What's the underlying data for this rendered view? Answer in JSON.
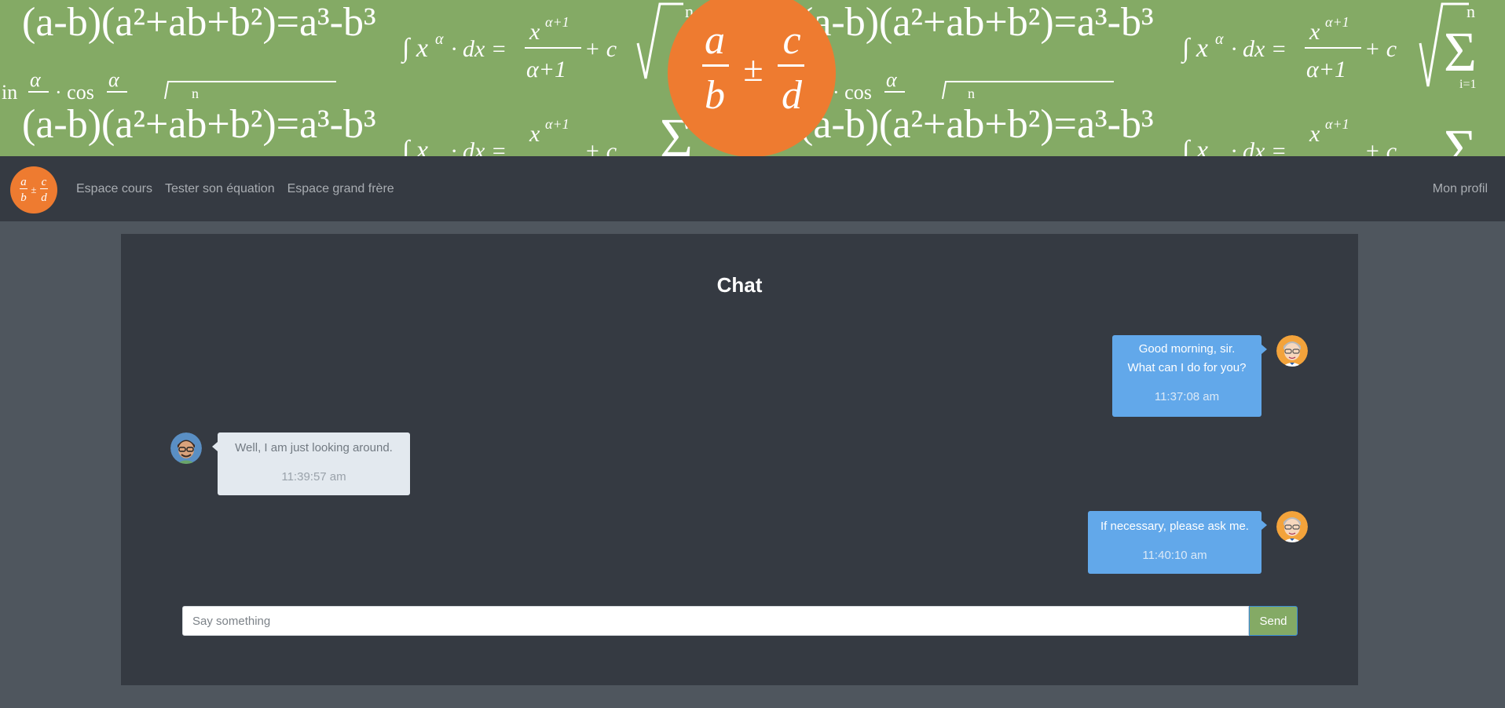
{
  "banner": {
    "logo": {
      "numerator_left": "a",
      "denominator_left": "b",
      "operator": "±",
      "numerator_right": "c",
      "denominator_right": "d"
    },
    "formulas": {
      "factorization": "(a-b)(a²+ab+b²)=a³-b³",
      "integral_lhs": "∫ x",
      "integral_exp": "α",
      "integral_mid": "· dx =",
      "integral_num": "x",
      "integral_num_exp": "α+1",
      "integral_den": "α+1",
      "integral_tail": "+ c",
      "sum_top": "n",
      "sum_bottom": "i=1",
      "trig_fragment": "in",
      "trig_cos": "· cos",
      "trig_alpha": "α",
      "root_index": "n"
    },
    "colors": {
      "background": "#84aa65",
      "logo": "#ee7b30"
    }
  },
  "navbar": {
    "logo": {
      "numerator_left": "a",
      "denominator_left": "b",
      "operator": "±",
      "numerator_right": "c",
      "denominator_right": "d"
    },
    "links": [
      "Espace cours",
      "Tester son équation",
      "Espace grand frère"
    ],
    "profile": "Mon profil"
  },
  "chat": {
    "title": "Chat",
    "messages": [
      {
        "sender": "me",
        "lines": [
          "Good morning, sir.",
          "What can I do for you?"
        ],
        "time": "11:37:08 am"
      },
      {
        "sender": "other",
        "lines": [
          "Well, I am just looking around."
        ],
        "time": "11:39:57 am"
      },
      {
        "sender": "me",
        "lines": [
          "If necessary, please ask me."
        ],
        "time": "11:40:10 am"
      }
    ],
    "input": {
      "placeholder": "Say something",
      "value": ""
    },
    "send_label": "Send"
  },
  "colors": {
    "navbar": "#353a42",
    "page": "#4f565e",
    "my_bubble": "#62a8ea",
    "other_bubble": "#e3e9ef",
    "send": "#84aa65"
  }
}
